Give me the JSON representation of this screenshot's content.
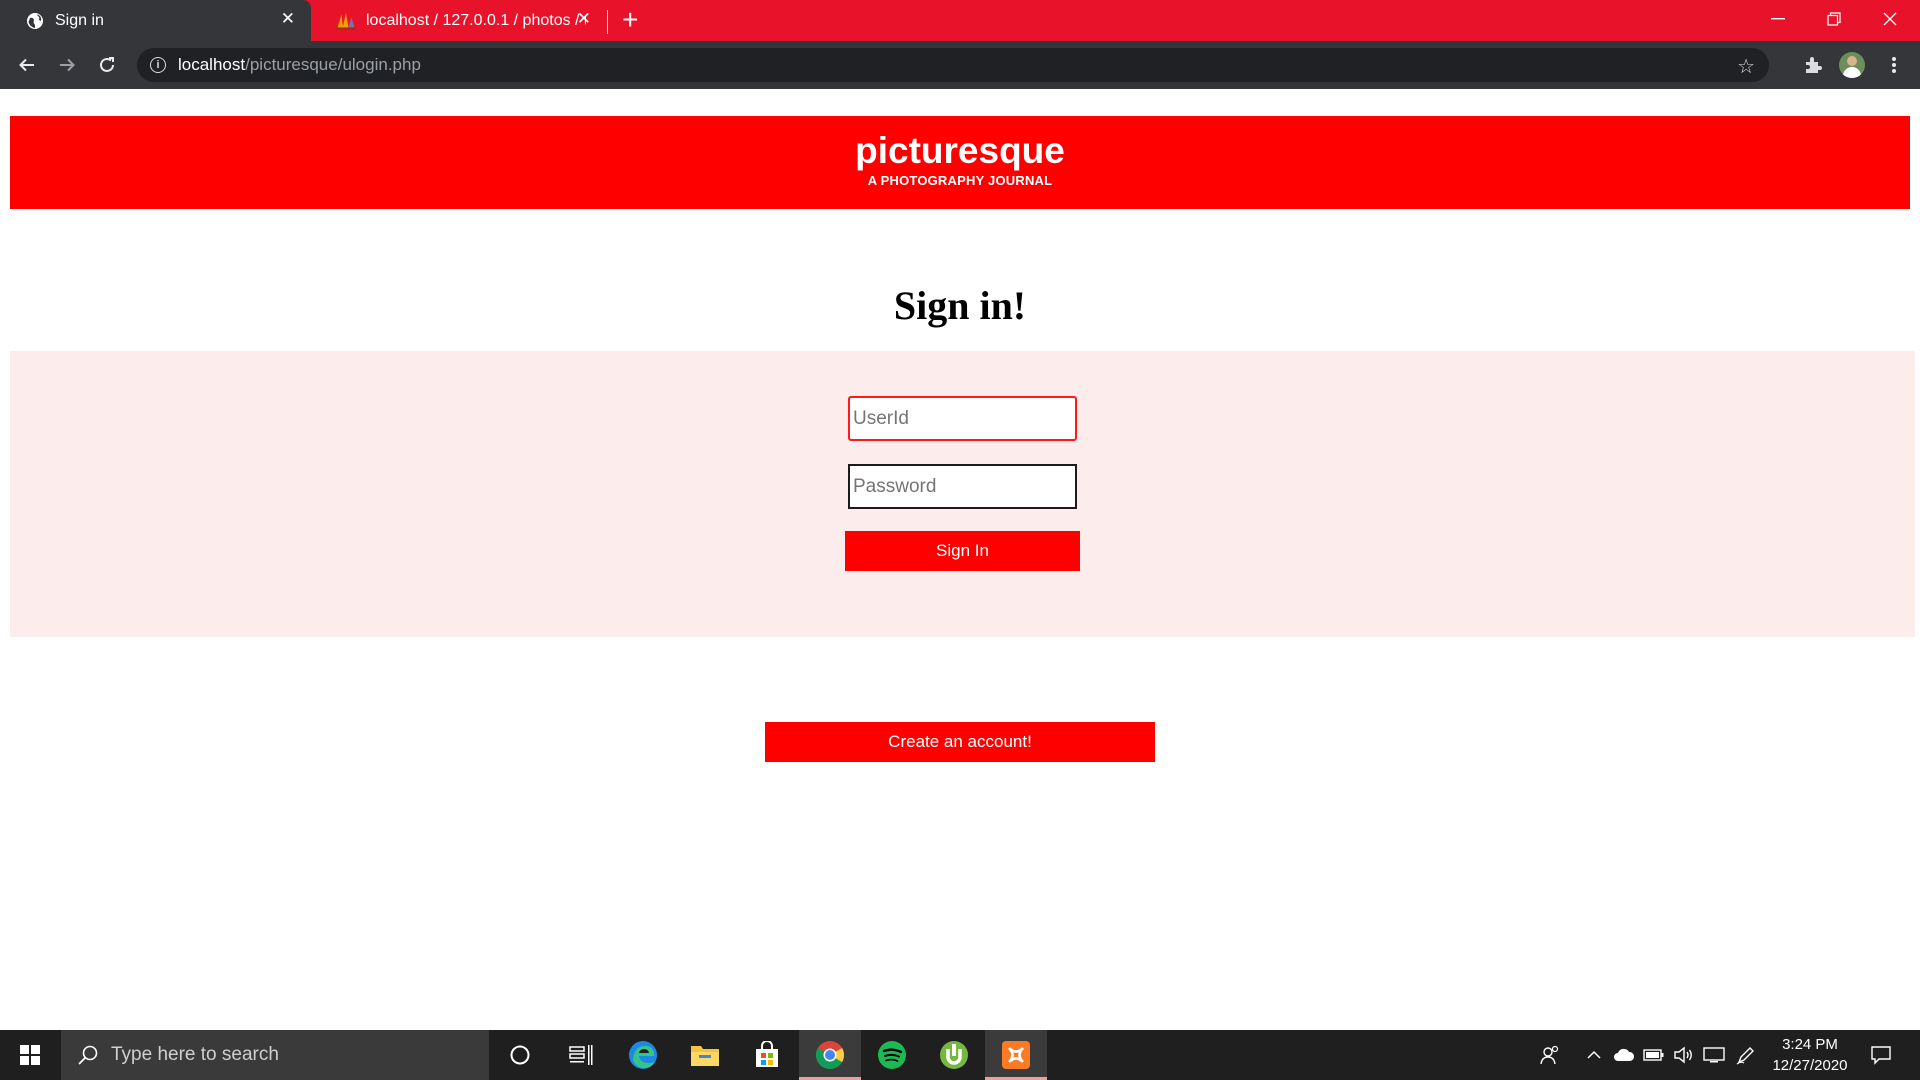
{
  "browser": {
    "tabs": [
      {
        "title": "Sign in",
        "icon": "globe-icon",
        "active": true
      },
      {
        "title": "localhost / 127.0.0.1 / photos / u",
        "icon": "phpmyadmin-icon",
        "active": false
      }
    ],
    "url_host": "localhost",
    "url_path": "/picturesque/ulogin.php",
    "accent_color": "#e8132a"
  },
  "site": {
    "brand": "picturesque",
    "tagline": "A PHOTOGRAPHY JOURNAL",
    "brand_color": "#ff0000"
  },
  "form": {
    "heading": "Sign in!",
    "userid_placeholder": "UserId",
    "userid_value": "",
    "password_placeholder": "Password",
    "password_value": "",
    "signin_label": "Sign In",
    "create_account_label": "Create an account!"
  },
  "taskbar": {
    "search_placeholder": "Type here to search",
    "apps": [
      "cortana-icon",
      "task-view-icon",
      "edge-icon",
      "file-explorer-icon",
      "store-icon",
      "chrome-icon",
      "spotify-icon",
      "utorrent-icon",
      "xampp-icon"
    ],
    "time": "3:24 PM",
    "date": "12/27/2020"
  }
}
